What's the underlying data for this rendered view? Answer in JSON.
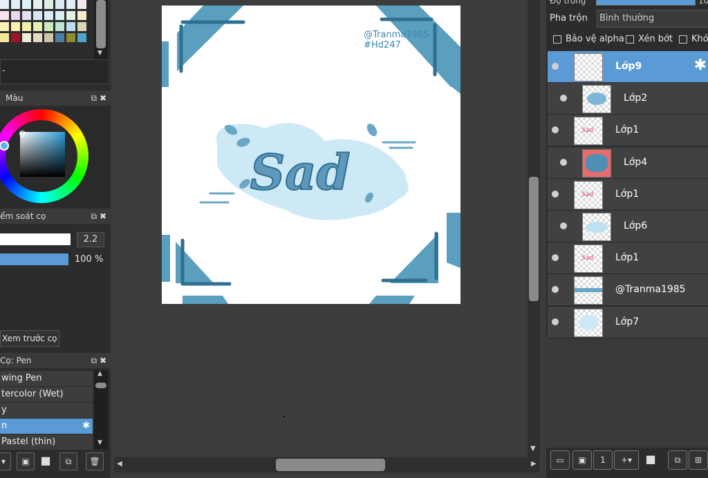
{
  "colors": {
    "accent": "#5b9bd5",
    "panel": "#2c2c2c",
    "canvas_bg": "#3d3d3d",
    "teal": "#2f7fa3"
  },
  "palette": {
    "rows": [
      [
        "#e9f1f7",
        "#dfeef5",
        "#ddf0f2",
        "#e3f2ec",
        "#dcefe0",
        "#dbe9f4",
        "#e0ecf7",
        "#f5e6ef"
      ],
      [
        "#fbe0ef",
        "#e9d8ef",
        "#e4dff2",
        "#d6e4f5",
        "#d9ecf7",
        "#d7f0f2",
        "#e1f2e4",
        "#fcecc8"
      ],
      [
        "#fff0b5",
        "#fff2b0",
        "#f4f1ad",
        "#e7f0b3",
        "#cfe8bd",
        "#bfe3d6",
        "#c0dcef",
        "#d8d7b0"
      ],
      [
        "#f4e79a",
        "#a6122a",
        "#f2ebd7",
        "#e6dbc0",
        "#c9c5a6",
        "#4c7fa8",
        "#8d8c30",
        "#4ea5c9"
      ]
    ]
  },
  "blending": {
    "label": "Pha trộn",
    "value": "Bình thường",
    "opacity_label": "Độ trong",
    "opacity_value": "10"
  },
  "options": {
    "protect_alpha": "Bảo vệ alpha",
    "clip": "Xén bớt",
    "lock": "Khóa"
  },
  "color_panel": {
    "title": "Màu"
  },
  "brush_control": {
    "title": "ểm soát cọ",
    "size_value": "2.2",
    "opacity_value": "100 %",
    "preview_label": "Xem trước cọ"
  },
  "brush_list": {
    "title": "Cọ: Pen",
    "items": [
      {
        "label": "wing Pen",
        "selected": false
      },
      {
        "label": "tercolor (Wet)",
        "selected": false
      },
      {
        "label": "y",
        "selected": false
      },
      {
        "label": "n",
        "selected": true
      },
      {
        "label": "Pastel (thin)",
        "selected": false
      }
    ]
  },
  "artwork": {
    "watermark_line1": "@Tranma1985",
    "watermark_line2": "#Hd247",
    "title": "Sad"
  },
  "layers": [
    {
      "name": "Lớp9",
      "selected": true,
      "indent": false,
      "thumb": "blank"
    },
    {
      "name": "Lớp2",
      "selected": false,
      "indent": true,
      "thumb": "blue"
    },
    {
      "name": "Lớp1",
      "selected": false,
      "indent": false,
      "thumb": "sad"
    },
    {
      "name": "Lớp4",
      "selected": false,
      "indent": true,
      "thumb": "blob"
    },
    {
      "name": "Lớp1",
      "selected": false,
      "indent": false,
      "thumb": "sad"
    },
    {
      "name": "Lớp6",
      "selected": false,
      "indent": true,
      "thumb": "cloud"
    },
    {
      "name": "Lớp1",
      "selected": false,
      "indent": false,
      "thumb": "sad"
    },
    {
      "name": "@Tranma1985",
      "selected": false,
      "indent": false,
      "thumb": "text"
    },
    {
      "name": "Lớp7",
      "selected": false,
      "indent": false,
      "thumb": "frame"
    }
  ]
}
